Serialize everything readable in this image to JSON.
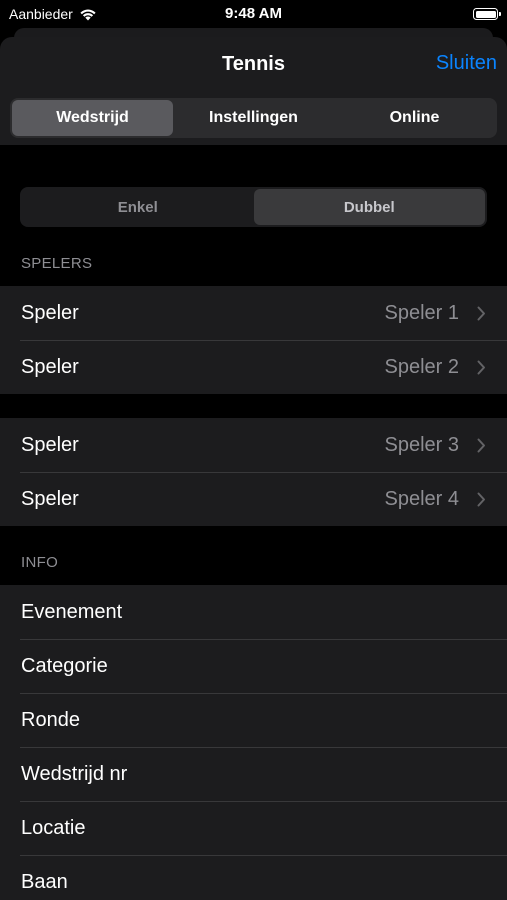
{
  "status": {
    "carrier": "Aanbieder",
    "time": "9:48 AM"
  },
  "header": {
    "title": "Tennis",
    "close_label": "Sluiten"
  },
  "tabs": [
    {
      "label": "Wedstrijd",
      "active": true
    },
    {
      "label": "Instellingen",
      "active": false
    },
    {
      "label": "Online",
      "active": false
    }
  ],
  "mode": [
    {
      "label": "Enkel",
      "active": false
    },
    {
      "label": "Dubbel",
      "active": true
    }
  ],
  "players_section": {
    "title": "SPELERS",
    "groups": [
      [
        {
          "label": "Speler",
          "value": "Speler 1"
        },
        {
          "label": "Speler",
          "value": "Speler 2"
        }
      ],
      [
        {
          "label": "Speler",
          "value": "Speler 3"
        },
        {
          "label": "Speler",
          "value": "Speler 4"
        }
      ]
    ]
  },
  "info_section": {
    "title": "INFO",
    "rows": [
      "Evenement",
      "Categorie",
      "Ronde",
      "Wedstrijd nr",
      "Locatie",
      "Baan"
    ]
  },
  "colors": {
    "accent": "#0a84ff",
    "background": "#000000",
    "cell": "#1c1c1e",
    "secondary_text": "#8e8e93"
  }
}
